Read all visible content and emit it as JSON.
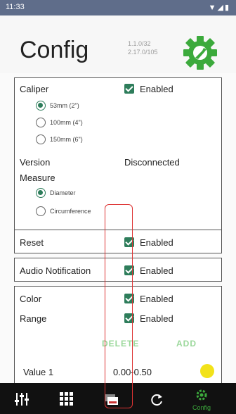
{
  "status": {
    "time": "11:33",
    "icons": "▼◢▮"
  },
  "header": {
    "title": "Config",
    "version1": "1.1.0/32",
    "version2": "2.17.0/105"
  },
  "caliper": {
    "label": "Caliper",
    "enabled": "Enabled",
    "options": [
      "53mm (2\")",
      "100mm (4\")",
      "150mm (6\")"
    ],
    "version_label": "Version",
    "version_value": "Disconnected",
    "measure_label": "Measure",
    "measure_options": [
      "Diameter",
      "Circumference"
    ]
  },
  "reset": {
    "label": "Reset",
    "enabled": "Enabled"
  },
  "audio": {
    "label": "Audio Notification",
    "enabled": "Enabled"
  },
  "color": {
    "label": "Color",
    "enabled": "Enabled",
    "range_label": "Range",
    "range_enabled": "Enabled",
    "delete_label": "DELETE",
    "add_label": "ADD",
    "value_label": "Value 1",
    "value_range": "0.00-0.50",
    "swatch": "#f2e21a"
  },
  "nav": {
    "active_label": "Config"
  },
  "colors": {
    "accent": "#2e7d5b",
    "gear": "#3caa3c",
    "annotation": "#d33"
  }
}
